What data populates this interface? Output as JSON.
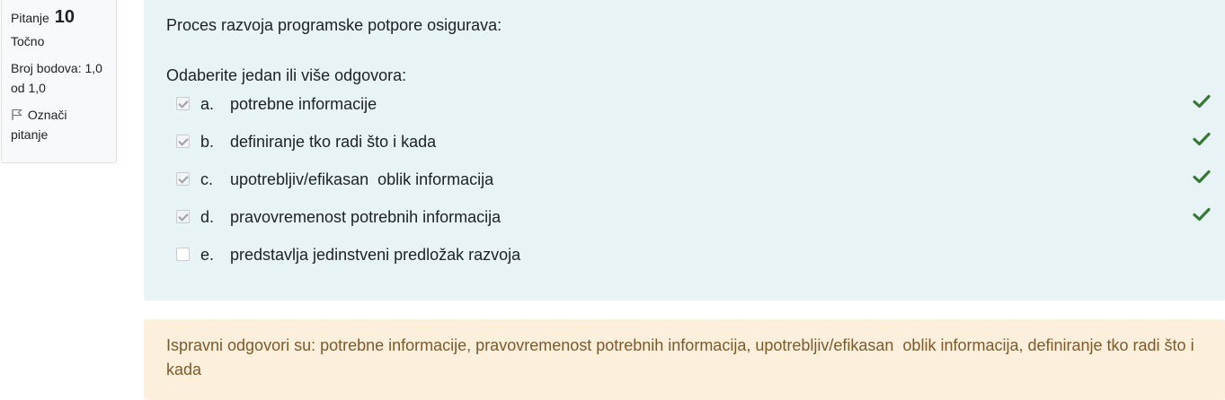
{
  "info": {
    "question_label": "Pitanje",
    "question_number": "10",
    "state": "Točno",
    "grade": "Broj bodova: 1,0 od 1,0",
    "flag_label": "Označi pitanje"
  },
  "question": {
    "text": "Proces razvoja programske potpore osigurava:",
    "prompt": "Odaberite jedan ili više odgovora:",
    "answers": [
      {
        "letter": "a.",
        "text": "potrebne informacije",
        "checked": true,
        "correct": true
      },
      {
        "letter": "b.",
        "text": "definiranje tko radi što i kada",
        "checked": true,
        "correct": true
      },
      {
        "letter": "c.",
        "text": "upotrebljiv/efikasan  oblik informacija",
        "checked": true,
        "correct": true
      },
      {
        "letter": "d.",
        "text": "pravovremenost potrebnih informacija",
        "checked": true,
        "correct": true
      },
      {
        "letter": "e.",
        "text": "predstavlja jedinstveni predložak razvoja",
        "checked": false,
        "correct": false
      }
    ]
  },
  "feedback": {
    "right_answer": "Ispravni odgovori su: potrebne informacije, pravovremenost potrebnih informacija, upotrebljiv/efikasan  oblik informacija, definiranje tko radi što i kada"
  },
  "colors": {
    "formulation_bg": "#e7f3f5",
    "feedback_bg": "#fcefdc",
    "feedback_text": "#7d5a29",
    "correct_check": "#357a32"
  },
  "icons": {
    "flag": "flag-icon",
    "correct": "check-icon"
  }
}
